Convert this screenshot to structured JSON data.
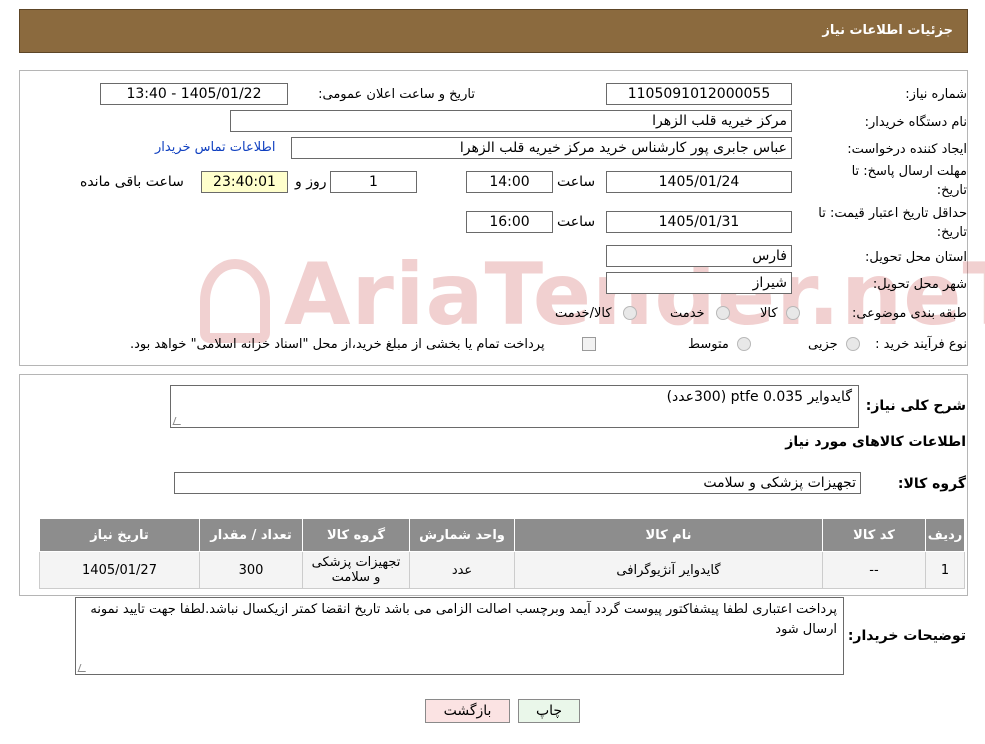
{
  "header": {
    "title": "جزئیات اطلاعات نیاز"
  },
  "watermark": "AriaTender.neT",
  "form": {
    "need_number_label": "شماره نیاز:",
    "need_number": "1105091012000055",
    "announce_label": "تاریخ و ساعت اعلان عمومی:",
    "announce_value": "1405/01/22 - 13:40",
    "buyer_org_label": "نام دستگاه خریدار:",
    "buyer_org": "مرکز خیریه قلب الزهرا",
    "creator_label": "ایجاد کننده درخواست:",
    "creator": "عباس جابری پور کارشناس خرید مرکز خیریه قلب الزهرا",
    "contact_link": "اطلاعات تماس خریدار",
    "deadline_label_1": "مهلت ارسال پاسخ: تا",
    "deadline_label_2": "تاریخ:",
    "deadline_date": "1405/01/24",
    "time_label": "ساعت",
    "deadline_time": "14:00",
    "days_value": "1",
    "days_label": "روز و",
    "remaining_time": "23:40:01",
    "remaining_label": "ساعت باقی مانده",
    "validity_label_1": "حداقل تاریخ اعتبار قیمت: تا",
    "validity_label_2": "تاریخ:",
    "validity_date": "1405/01/31",
    "validity_time_label": "ساعت",
    "validity_time": "16:00",
    "province_label": "استان محل تحویل:",
    "province": "فارس",
    "city_label": "شهر محل تحویل:",
    "city": "شیراز",
    "category_label": "طبقه بندی موضوعی:",
    "category_options": [
      "کالا",
      "خدمت",
      "کالا/خدمت"
    ],
    "process_label": "نوع فرآیند خرید :",
    "process_options": [
      "جزیی",
      "متوسط"
    ],
    "process_note": "پرداخت تمام یا بخشی از مبلغ خرید،از محل \"اسناد خزانه اسلامی\" خواهد بود."
  },
  "summary": {
    "title_label": "شرح کلی نیاز:",
    "description": "گایدوایر ptfe 0.035   (300عدد)",
    "goods_info_title": "اطلاعات کالاهای مورد نیاز",
    "group_label": "گروه کالا:",
    "group_value": "تجهیزات پزشکی و سلامت"
  },
  "table": {
    "headers": [
      "ردیف",
      "کد کالا",
      "نام کالا",
      "واحد شمارش",
      "گروه کالا",
      "تعداد / مقدار",
      "تاریخ نیاز"
    ],
    "rows": [
      [
        "1",
        "--",
        "گایدوایر آنژیوگرافی",
        "عدد",
        "تجهیزات پزشکی و سلامت",
        "300",
        "1405/01/27"
      ]
    ]
  },
  "buyer_notes": {
    "label": "توضیحات خریدار:",
    "text": "پرداخت اعتباری لطفا پیشفاکتور پیوست گردد آیمد وبرچسب اصالت الزامی می باشد تاریخ انقضا کمتر ازیکسال نباشد.لطفا جهت تایید نمونه ارسال شود"
  },
  "buttons": {
    "print": "چاپ",
    "back": "بازگشت"
  }
}
